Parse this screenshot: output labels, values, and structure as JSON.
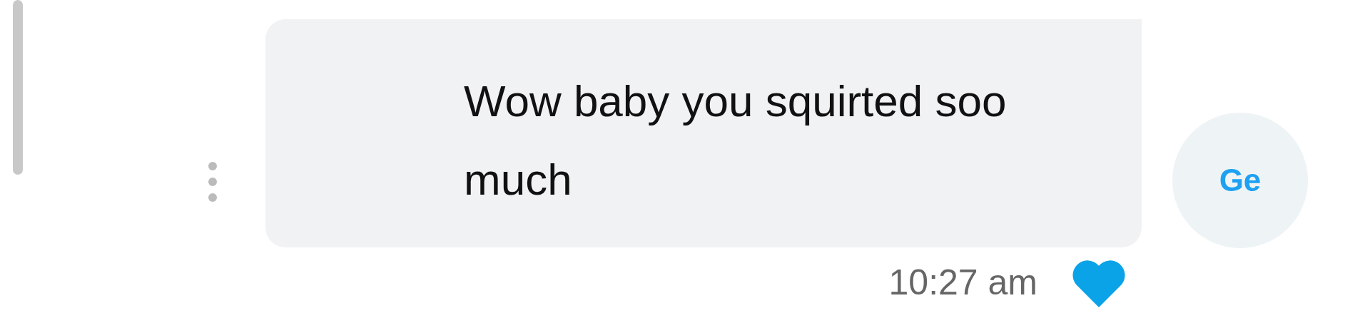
{
  "message": {
    "avatar": "Ge",
    "text": "Wow baby you squirted soo much",
    "time": "10:27 am",
    "liked": true
  }
}
